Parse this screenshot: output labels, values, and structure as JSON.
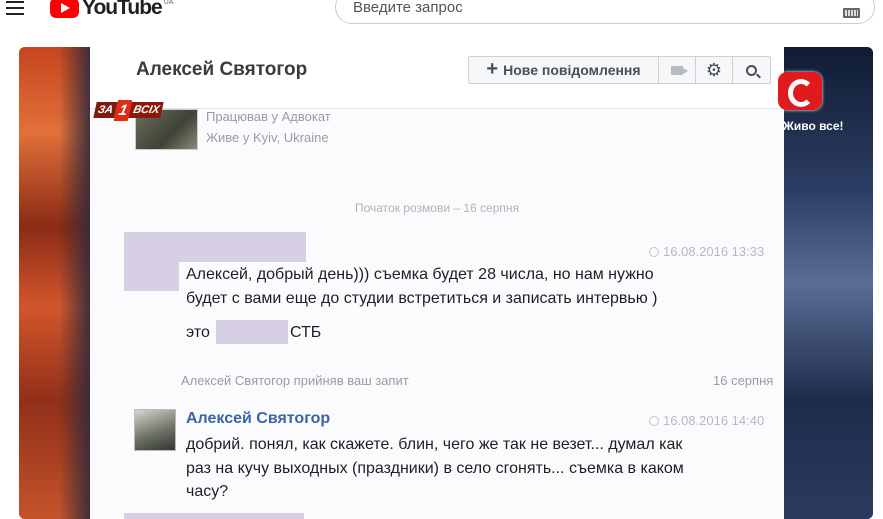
{
  "youtube": {
    "logo_text": "YouTube",
    "region_label": "UA",
    "search_placeholder": "Введите запрос"
  },
  "video": {
    "channel_bug": [
      "ЗА",
      "1",
      "ВСІХ"
    ],
    "stb_slogan": "Живо все!",
    "messenger": {
      "contact_name": "Алексей Святогор",
      "new_message_label": "Нове повідомлення",
      "profile": {
        "work": "Працював у Адвокат",
        "lives": "Живе у Kyiv, Ukraine"
      },
      "conversation_start": "Початок розмови – 16 серпня",
      "messages": [
        {
          "time": "16.08.2016 13:33",
          "lines": [
            "Алексей, добрый день))) съемка будет 28 числа, но нам нужно",
            "будет с вами еще до студии встретиться и записать интервью )"
          ],
          "sig_prefix": "это",
          "sig_suffix": "СТБ"
        },
        {
          "author": "Алексей Святогор",
          "time": "16.08.2016 14:40",
          "lines": [
            "добрий. понял, как скажете. блин, чего же так не везет... думал как",
            "раз на кучу выходных (праздники) в село сгонять... съемка в каком",
            "часу?"
          ]
        }
      ],
      "accepted_notice": "Алексей Святогор прийняв ваш запит",
      "accepted_date": "16 серпня"
    }
  }
}
